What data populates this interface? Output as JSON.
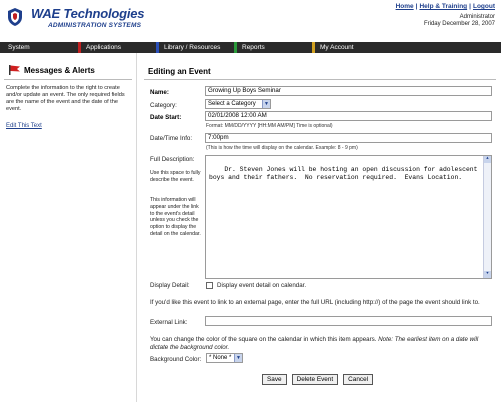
{
  "header": {
    "brand": "WAE Technologies",
    "subtitle": "ADMINISTRATION SYSTEMS",
    "links": [
      "Home",
      "Help & Training",
      "Logout"
    ],
    "separator": "|",
    "user_role": "Administrator",
    "date": "Friday December 28, 2007"
  },
  "nav": {
    "items": [
      "System",
      "Applications",
      "Library / Resources",
      "Reports",
      "My Account"
    ]
  },
  "left": {
    "title": "Messages & Alerts",
    "description": "Complete the information to the right to create and/or update an event. The only required fields are the name of the event and the date of the event.",
    "edit_link": "Edit This Text"
  },
  "form": {
    "title": "Editing an Event",
    "name_label": "Name:",
    "name_value": "Growing Up Boys Seminar",
    "category_label": "Category:",
    "category_value": "Select a Category",
    "date_start_label": "Date Start:",
    "date_start_value": "02/01/2008 12:00 AM",
    "date_format_hint": "Format: MM/DD/YYYY [HH:MM AM/PM] Time is optional)",
    "time_label": "Date/Time Info:",
    "time_value": "7:00pm",
    "time_hint": "(This is how the time will display on the calendar. Example: 8 - 9 pm)",
    "description_label": "Full Description:",
    "description_note1": "Use this space to fully describe the event.",
    "description_note2": "This information will appear under the link to the event's detail unless you check the option to display the detail on the calendar.",
    "description_value": "Dr. Steven Jones will be hosting an open discussion for adolescent boys and their fathers.  No reservation required.  Evans Location.",
    "display_detail_label": "Display Detail:",
    "display_detail_text": "Display event detail on calendar.",
    "link_intro": "If you'd like this event to link to an external page, enter the full URL (including http://) of the page the event should link to.",
    "external_link_label": "External Link:",
    "external_link_value": "",
    "color_intro": "You can change the color of the square on the calendar in which this item appears.",
    "color_note": "Note: The earliest item on a date will dictate the background color.",
    "bg_color_label": "Background Color:",
    "bg_color_value": "* None *",
    "buttons": {
      "save": "Save",
      "delete": "Delete Event",
      "cancel": "Cancel"
    }
  },
  "colors": {
    "brand_blue": "#1e3f8c",
    "nav_bg": "#2a2a2a",
    "nav_system": "#2a2a2a",
    "nav_apps": "#c02020",
    "nav_library": "#2a4fb8",
    "nav_reports": "#2a9a3a",
    "nav_account": "#d0a020"
  }
}
